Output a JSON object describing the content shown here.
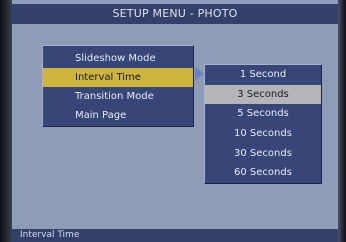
{
  "header": {
    "title": "SETUP MENU - PHOTO"
  },
  "menu": {
    "items": [
      {
        "label": "Slideshow Mode"
      },
      {
        "label": "Interval Time"
      },
      {
        "label": "Transition Mode"
      },
      {
        "label": "Main Page"
      }
    ],
    "selected_index": 1
  },
  "submenu": {
    "items": [
      {
        "label": "1 Second"
      },
      {
        "label": "3 Seconds"
      },
      {
        "label": "5 Seconds"
      },
      {
        "label": "10 Seconds"
      },
      {
        "label": "30 Seconds"
      },
      {
        "label": "60 Seconds"
      }
    ],
    "selected_index": 1
  },
  "status": {
    "text": "Interval Time"
  },
  "colors": {
    "menu_background": "#364679",
    "selection_highlight": "#cdb43d",
    "submenu_highlight": "#b4b5b9",
    "screen_background": "#8e9cb8"
  },
  "icons": {
    "submenu_pointer": "chevron-right-icon"
  }
}
